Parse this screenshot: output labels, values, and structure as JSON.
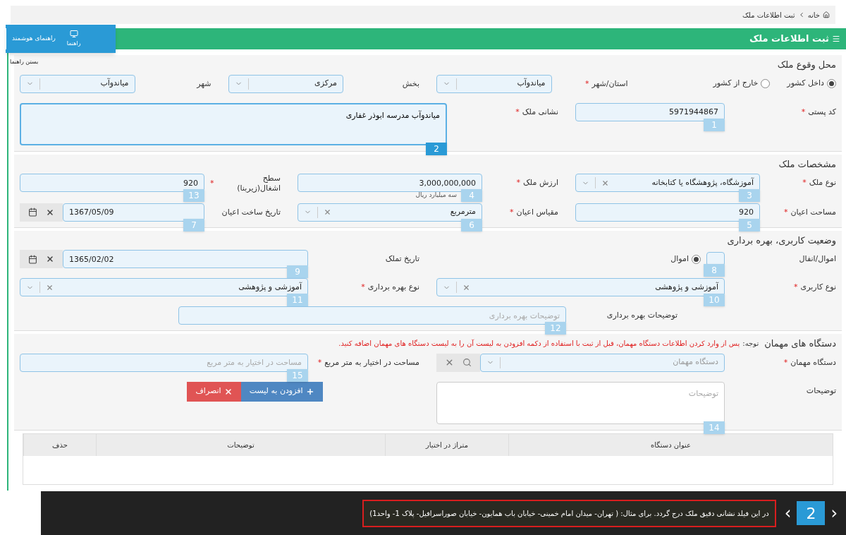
{
  "breadcrumb": [
    {
      "label": "خانه"
    },
    {
      "label": "ثبت اطلاعات ملک"
    }
  ],
  "header": {
    "title": "ثبت اطلاعات ملک"
  },
  "guide": {
    "title": "راهنمای هوشمند",
    "button": "راهنما",
    "close": "بستن راهنما"
  },
  "required_mark": "*",
  "sections": [
    {
      "title": "محل وقوع ملک",
      "rows": [
        [
          {
            "kind": "radio",
            "options": [
              {
                "label": "داخل کشور",
                "selected": true
              },
              {
                "label": "خارج از کشور",
                "selected": false
              }
            ]
          },
          {
            "kind": "select",
            "label": "استان/شهر",
            "required": true,
            "value": "میاندوآب"
          },
          {
            "kind": "select",
            "label": "بخش",
            "required": false,
            "value": "مرکزی"
          },
          {
            "kind": "select",
            "label": "شهر",
            "required": false,
            "value": "میاندوآب"
          }
        ],
        [
          {
            "kind": "text",
            "label": "کد پستی",
            "required": true,
            "value": "5971944867",
            "badge": {
              "number": "1",
              "selected": false
            }
          },
          {
            "kind": "textarea",
            "label": "نشانی ملک",
            "required": true,
            "value": "میاندوآب مدرسه ابوذر غفاری",
            "badge": {
              "number": "2",
              "selected": true
            }
          }
        ]
      ]
    },
    {
      "title": "مشخصات ملک",
      "rows": [
        [
          {
            "kind": "select",
            "label": "نوع ملک",
            "required": true,
            "value": "آموزشگاه، پژوهشگاه یا کتابخانه",
            "clearable": true,
            "badge": {
              "number": "3",
              "selected": false
            }
          },
          {
            "kind": "text",
            "label": "ارزش ملک",
            "required": true,
            "value": "3,000,000,000",
            "hint": "سه میلیارد ریال",
            "badge": {
              "number": "4",
              "selected": false
            }
          },
          {
            "kind": "text",
            "label": "سطح اشغال(زیربنا)",
            "required": true,
            "value": "920",
            "badge": {
              "number": "13",
              "selected": false
            }
          }
        ],
        [
          {
            "kind": "text",
            "label": "مساحت اعیان",
            "required": true,
            "value": "920",
            "badge": {
              "number": "5",
              "selected": false
            }
          },
          {
            "kind": "select",
            "label": "مقیاس اعیان",
            "required": true,
            "value": "مترمربع",
            "clearable": true,
            "badge": {
              "number": "6",
              "selected": false
            }
          },
          {
            "kind": "date",
            "label": "تاریخ ساخت اعیان",
            "required": false,
            "value": "1367/05/09",
            "badge": {
              "number": "7",
              "selected": false
            }
          }
        ]
      ]
    },
    {
      "title": "وضعیت کاربری، بهره برداری",
      "rows": [
        [
          {
            "kind": "toggle",
            "label": "اموال/انفال",
            "option": {
              "label": "اموال",
              "selected": true
            },
            "badge": {
              "number": "8",
              "selected": false
            }
          },
          {
            "kind": "date",
            "label": "تاریخ تملک",
            "required": false,
            "value": "1365/02/02",
            "badge": {
              "number": "9",
              "selected": false
            }
          }
        ],
        [
          {
            "kind": "select",
            "label": "نوع کاربری",
            "required": true,
            "value": "آموزشی و پژوهشی",
            "clearable": true,
            "badge": {
              "number": "10",
              "selected": false
            }
          },
          {
            "kind": "select",
            "label": "نوع بهره برداری",
            "required": true,
            "value": "آموزشی و پژوهشی",
            "clearable": true,
            "badge": {
              "number": "11",
              "selected": false
            }
          }
        ],
        [
          {
            "kind": "text",
            "label": "توضیحات بهره برداری",
            "required": false,
            "placeholder": "توضیحات بهره برداری",
            "badge": {
              "number": "12",
              "selected": false
            }
          }
        ]
      ]
    },
    {
      "title": "دستگاه های مهمان",
      "note_label": "توجه:",
      "note": "پس از وارد کردن اطلاعات دستگاه مهمان، قبل از ثبت با استفاده از دکمه افزودن به لیست آن را به لیست دستگاه های مهمان اضافه کنید.",
      "rows": [
        [
          {
            "kind": "search-select",
            "label": "دستگاه مهمان",
            "required": true,
            "placeholder": "دستگاه مهمان"
          },
          {
            "kind": "text",
            "label": "مساحت در اختیار به متر مربع",
            "required": true,
            "placeholder": "مساحت در اختیار به متر مربع",
            "badge": {
              "number": "15",
              "selected": false
            }
          }
        ],
        [
          {
            "kind": "textarea",
            "label": "توضیحات",
            "required": false,
            "placeholder": "توضیحات",
            "badge": {
              "number": "14",
              "selected": false
            }
          },
          {
            "kind": "buttons",
            "buttons": [
              {
                "label": "افزودن به لیست"
              },
              {
                "label": "انصراف"
              }
            ]
          }
        ]
      ]
    }
  ],
  "table": {
    "columns": [
      "عنوان دستگاه",
      "متراژ در اختیار",
      "توضیحات",
      "حذف"
    ]
  },
  "tooltip": {
    "text": "در این فیلد نشانی دقیق ملک درج گردد. برای مثال: ( تهران- میدان امام خمینی- خیابان باب همایون- خیابان صوراسرافیل- پلاک 1- واحد1)",
    "prev": "‹",
    "step": "2",
    "next": "›"
  }
}
